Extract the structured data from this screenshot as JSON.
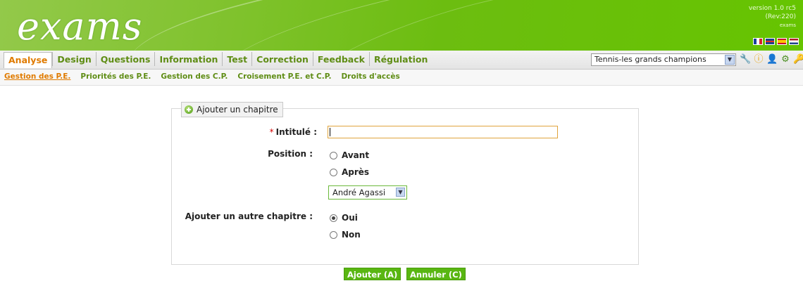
{
  "header": {
    "logo_text": "exams",
    "version_line": "version 1.0 rc5",
    "revision_line": "(Rev:220)",
    "user_line": "exams",
    "languages": [
      "fr",
      "uk",
      "es",
      "nl"
    ]
  },
  "nav": {
    "tabs": [
      {
        "label": "Analyse",
        "active": true
      },
      {
        "label": "Design",
        "active": false
      },
      {
        "label": "Questions",
        "active": false
      },
      {
        "label": "Information",
        "active": false
      },
      {
        "label": "Test",
        "active": false
      },
      {
        "label": "Correction",
        "active": false
      },
      {
        "label": "Feedback",
        "active": false
      },
      {
        "label": "Régulation",
        "active": false
      }
    ],
    "project_select": {
      "value": "Tennis-les grands champions"
    },
    "tool_icons": [
      "wrench-icon",
      "info-icon",
      "user-icon",
      "settings-icon",
      "key-icon"
    ]
  },
  "subnav": {
    "links": [
      {
        "label": "Gestion des P.E.",
        "active": true
      },
      {
        "label": "Priorités des P.E.",
        "active": false
      },
      {
        "label": "Gestion des C.P.",
        "active": false
      },
      {
        "label": "Croisement P.E. et C.P.",
        "active": false
      },
      {
        "label": "Droits d'accès",
        "active": false
      }
    ]
  },
  "form": {
    "legend": "Ajouter un chapitre",
    "required_marker": "*",
    "title_label": "Intitulé :",
    "title_value": "",
    "position_label": "Position :",
    "position_options": [
      {
        "label": "Avant",
        "checked": false
      },
      {
        "label": "Après",
        "checked": false
      }
    ],
    "chapter_select": {
      "value": "André Agassi"
    },
    "another_label": "Ajouter un autre chapitre :",
    "another_options": [
      {
        "label": "Oui",
        "checked": true
      },
      {
        "label": "Non",
        "checked": false
      }
    ]
  },
  "actions": {
    "add_label": "Ajouter (A)",
    "cancel_label": "Annuler (C)"
  },
  "colors": {
    "brand_green": "#66c400",
    "active_orange": "#e07b00",
    "button_green": "#59b612"
  }
}
